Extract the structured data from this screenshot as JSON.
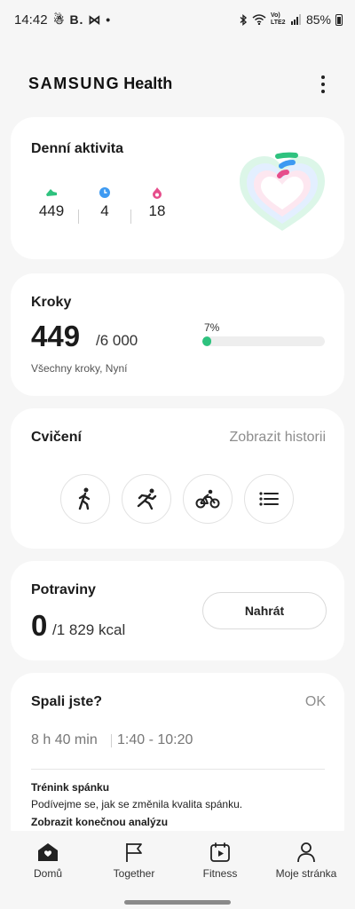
{
  "status_bar": {
    "time": "14:42",
    "notifications": "☃ B. ⋈ •",
    "network": "Vo) LTE2",
    "battery": "85%"
  },
  "header": {
    "brand_main": "SAMSUNG",
    "brand_sub": "Health",
    "more_icon": "more-vert-icon"
  },
  "daily_activity": {
    "title": "Denní aktivita",
    "metrics": [
      {
        "icon": "steps-icon",
        "value": "449",
        "color": "#2ec27e"
      },
      {
        "icon": "clock-icon",
        "value": "4",
        "color": "#3d9af2"
      },
      {
        "icon": "flame-icon",
        "value": "18",
        "color": "#e64d8b"
      }
    ]
  },
  "steps": {
    "title": "Kroky",
    "value": "449",
    "goal": "/6 000",
    "subtitle": "Všechny kroky, Nyní",
    "progress_label": "7%",
    "progress": 0.07
  },
  "exercise": {
    "title": "Cvičení",
    "history_link": "Zobrazit historii",
    "buttons": [
      "walking-icon",
      "running-icon",
      "cycling-icon",
      "list-icon"
    ]
  },
  "food": {
    "title": "Potraviny",
    "value": "0",
    "goal": "/1 829 kcal",
    "upload_label": "Nahrát"
  },
  "sleep": {
    "title": "Spali jste?",
    "ok_label": "OK",
    "duration": "8 h 40 min",
    "range": "1:40 - 10:20",
    "training_title": "Trénink spánku",
    "training_desc": "Podívejme se, jak se změnila kvalita spánku.",
    "analysis_link": "Zobrazit konečnou analýzu"
  },
  "nav": {
    "items": [
      {
        "label": "Domů",
        "icon": "home-icon"
      },
      {
        "label": "Together",
        "icon": "flag-icon"
      },
      {
        "label": "Fitness",
        "icon": "fitness-icon"
      },
      {
        "label": "Moje stránka",
        "icon": "profile-icon"
      }
    ]
  },
  "colors": {
    "accent_green": "#2ec27e",
    "accent_blue": "#3d9af2",
    "accent_pink": "#e64d8b",
    "background": "#f6f6f6",
    "card": "#ffffff"
  }
}
